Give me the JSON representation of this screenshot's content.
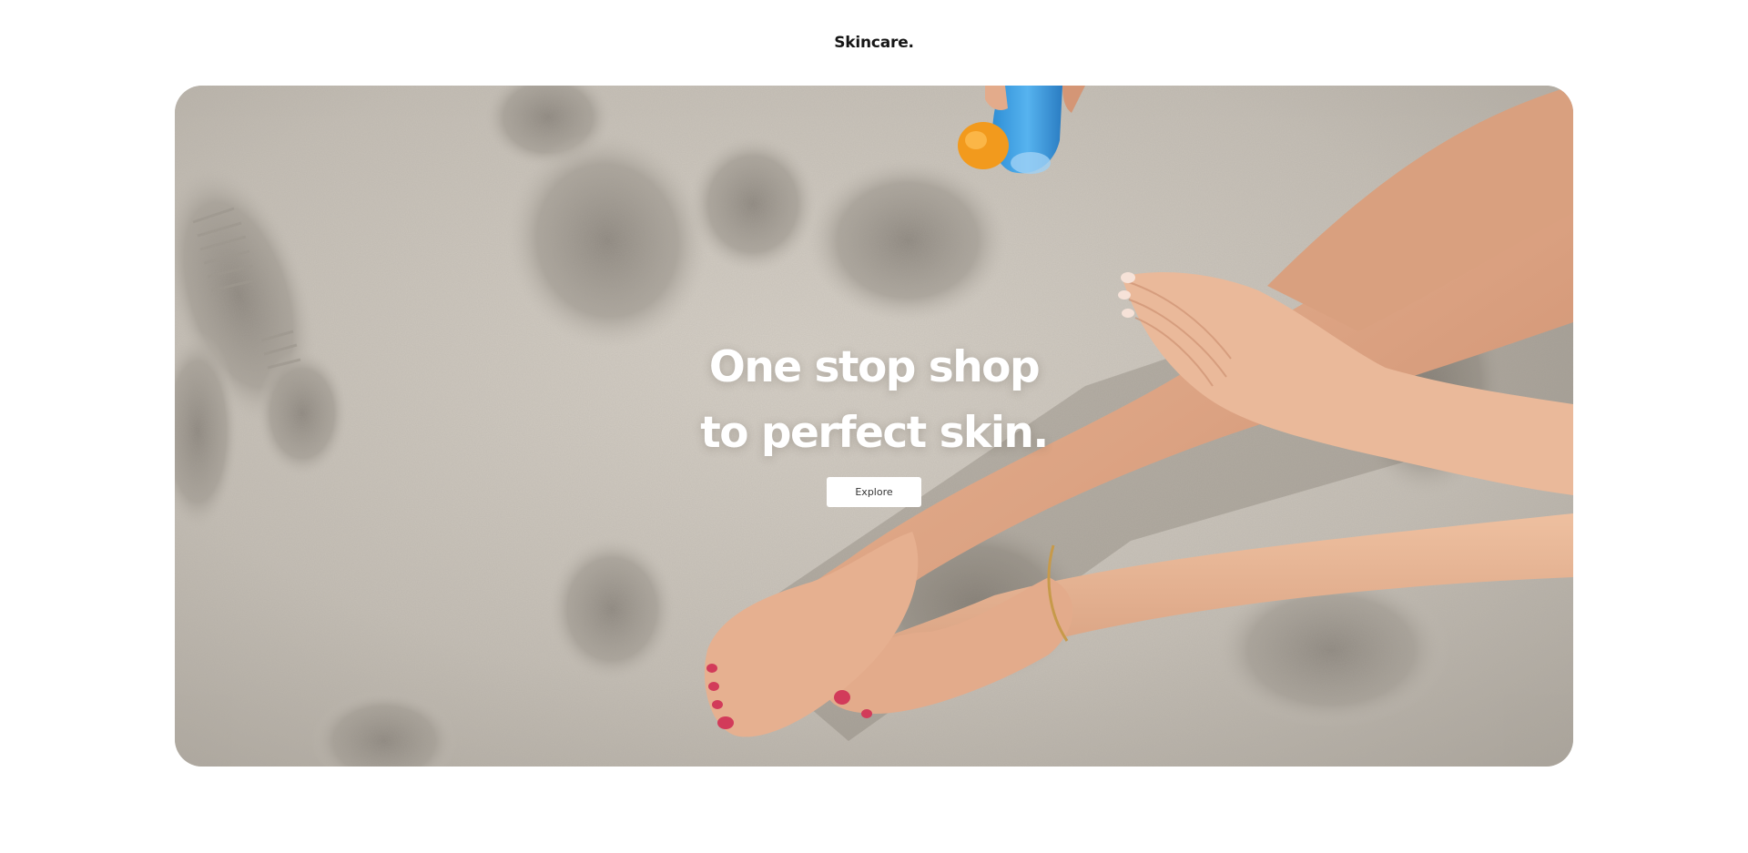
{
  "header": {
    "brand": "Skincare."
  },
  "hero": {
    "headline_line1": "One stop shop",
    "headline_line2": "to perfect skin.",
    "cta_label": "Explore",
    "image_description_icon": "beach-legs-sunscreen-photo"
  },
  "colors": {
    "background": "#ffffff",
    "sand": "#c6c0b7",
    "headline": "#ffffff",
    "button_bg": "#ffffff",
    "button_text": "#333333",
    "brand_text": "#161616"
  }
}
